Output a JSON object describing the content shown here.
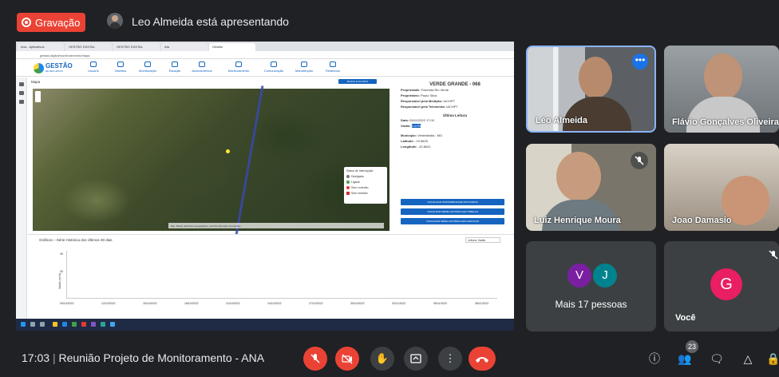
{
  "meet": {
    "recording_label": "Gravação",
    "presenting_text": "Leo Almeida está apresentando",
    "time": "17:03",
    "separator": "|",
    "meeting_title": "Reunião Projeto de Monitoramento - ANA",
    "participant_count": "23",
    "colors": {
      "background": "#202124",
      "red": "#ea4335",
      "button_grey": "#3c4043"
    }
  },
  "participants": [
    {
      "name": "Léo Almeida",
      "muted": false
    },
    {
      "name": "Flávio Gonçalves Oliveira",
      "muted": false
    },
    {
      "name": "Luiz Henrique Moura",
      "muted": true
    },
    {
      "name": "Joao Damasio",
      "muted": false
    }
  ],
  "more_tile": {
    "avatars": [
      "V",
      "J"
    ],
    "label": "Mais 17 pessoas"
  },
  "self_tile": {
    "avatar": "G",
    "label": "Você"
  },
  "shared_screen": {
    "browser_tabs": [
      "Ana - Aplicativos",
      "GESTÃO DIGITAL",
      "GESTÃO DIGITAL",
      "Ata",
      "Gestão"
    ],
    "url": "gestao.digital/monitoramento/mapa",
    "app_logo": "GESTÃO",
    "app_logo_sub": "DE RECURSOS",
    "nav": [
      "Usuário",
      "Distritos",
      "Monitoração",
      "Estação",
      "Acionamentos",
      "Monitoramento",
      "Comunicação",
      "Manutenção",
      "Relatórios"
    ],
    "map_title": "Mapa",
    "map_button": "BUSCA E FILTROS",
    "legend_title": "Status de Interrupção",
    "legend_items": [
      "Desligada",
      "Ligada",
      "Sem conexão",
      "Sem medidor"
    ],
    "attribution": "Esri, Maxar, Earthstar Geographics, and the GIS User Community",
    "info": {
      "title": "VERDE GRANDE - 068",
      "rows": [
        {
          "k": "Propriedade:",
          "v": "Fazenda Rio Verde"
        },
        {
          "k": "Proprietário:",
          "v": "Paulo Silva"
        },
        {
          "k": "Responsável pela Medição:",
          "v": "IACHPT"
        },
        {
          "k": "Responsável pela Telemetria:",
          "v": "IACHPT"
        }
      ],
      "last_reading_title": "Última Leitura",
      "reading": [
        {
          "k": "Data:",
          "v": "09/11/2022 17:00"
        },
        {
          "k": "Vazão:",
          "v": "0 m³/h"
        }
      ],
      "location": [
        {
          "k": "Município:",
          "v": "Verdelândia - MG"
        },
        {
          "k": "Latitude:",
          "v": "-15.5626"
        },
        {
          "k": "Longitude:",
          "v": "-43.8041"
        }
      ],
      "buttons": [
        "VISUALIZAR DISPONIBILIDADE DOS DADOS",
        "VISUALIZAR SÉRIE HISTÓRICA EM TABELAS",
        "VISUALIZAR SÉRIE HISTÓRICA EM GRÁFICOS"
      ]
    },
    "chart": {
      "title": "Gráficos – Série Histórica dos Últimos 30 dias",
      "select_label": "Leitura:",
      "select_value": "Vazão",
      "ylabel": "Vazão (m³/h)",
      "ytick_top": "45",
      "ytick_mid": "30",
      "dates": [
        "09/10/2022",
        "12/10/2022",
        "15/10/2022",
        "18/10/2022",
        "21/10/2022",
        "24/10/2022",
        "27/10/2022",
        "30/10/2022",
        "02/11/2022",
        "05/11/2022",
        "08/11/2022"
      ]
    }
  }
}
